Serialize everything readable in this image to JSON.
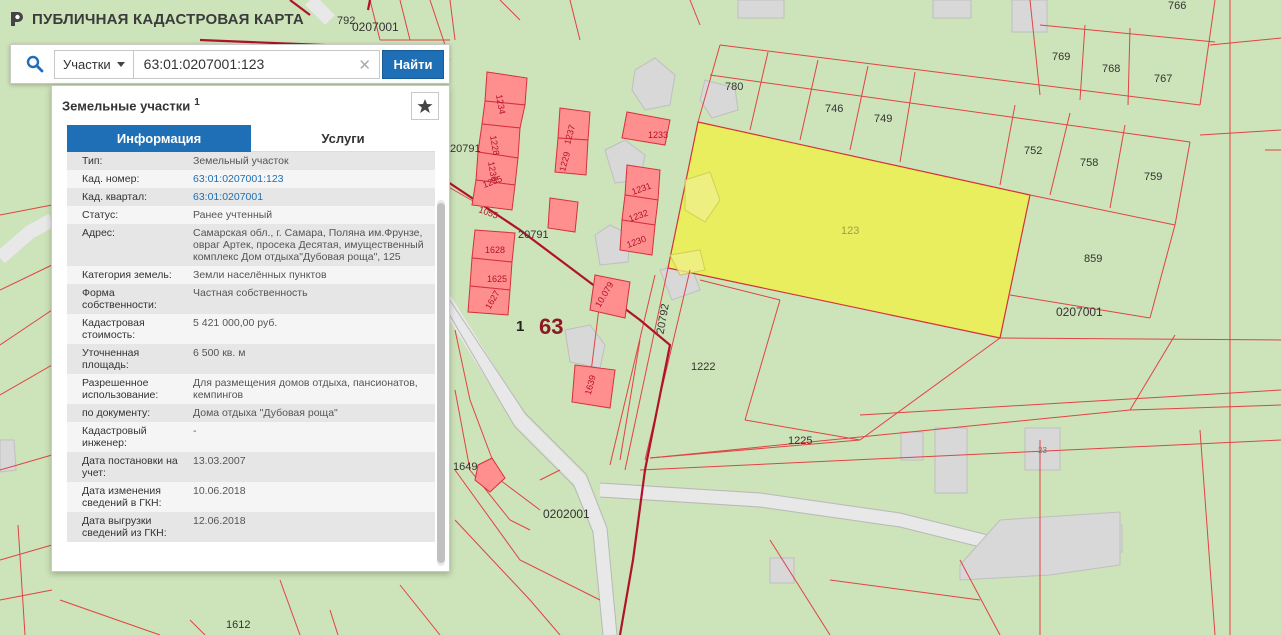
{
  "app": {
    "title": "ПУБЛИЧНАЯ КАДАСТРОВАЯ КАРТА"
  },
  "search": {
    "type_label": "Участки",
    "query": "63:01:0207001:123",
    "button_label": "Найти"
  },
  "panel": {
    "title": "Земельные участки",
    "count": "1",
    "tabs": [
      {
        "label": "Информация",
        "active": true
      },
      {
        "label": "Услуги",
        "active": false
      }
    ],
    "rows": [
      {
        "key": "Тип:",
        "value": "Земельный участок"
      },
      {
        "key": "Кад. номер:",
        "value": "63:01:0207001:123",
        "link": true
      },
      {
        "key": "Кад. квартал:",
        "value": "63:01:0207001",
        "link": true
      },
      {
        "key": "Статус:",
        "value": "Ранее учтенный"
      },
      {
        "key": "Адрес:",
        "value": "Самарская обл., г. Самара, Поляна им.Фрунзе, овраг Артек, просека Десятая, имущественный комплекс Дом отдыха\"Дубовая роща\", 125"
      },
      {
        "key": "Категория земель:",
        "value": "Земли населённых пунктов"
      },
      {
        "key": "Форма собственности:",
        "value": "Частная собственность"
      },
      {
        "key": "Кадастровая стоимость:",
        "value": "5 421 000,00 руб."
      },
      {
        "key": "Уточненная площадь:",
        "value": "6 500 кв. м"
      },
      {
        "key": "Разрешенное использование:",
        "value": "Для размещения домов отдыха, пансионатов, кемпингов"
      },
      {
        "key": "по документу:",
        "value": "Дома отдыха \"Дубовая роща\""
      },
      {
        "key": "Кадастровый инженер:",
        "value": "-"
      },
      {
        "key": "Дата постановки на учет:",
        "value": "13.03.2007"
      },
      {
        "key": "Дата изменения сведений в ГКН:",
        "value": "10.06.2018"
      },
      {
        "key": "Дата выгрузки сведений из ГКН:",
        "value": "12.06.2018"
      }
    ]
  },
  "map": {
    "colors": {
      "background": "#cde3b9",
      "boundary": "#d6303a",
      "selected": "#e8ee5e",
      "building": "#ff8f8f",
      "road": "#e6e6e6"
    },
    "labels": [
      "792",
      "0207001",
      "766",
      "780",
      "746",
      "749",
      "769",
      "768",
      "767",
      "752",
      "758",
      "759",
      "859",
      "123",
      "0207001",
      "1222",
      "1225",
      "0202001",
      "1649",
      "1612",
      "20791",
      "20791",
      "20792",
      "1",
      "63",
      "1233",
      "1231",
      "1232",
      "1230",
      "1229",
      "1237",
      "1628",
      "1625",
      "1627",
      "1228",
      "1236",
      "1235",
      "1234",
      "1639",
      "10.079",
      "1055",
      "23"
    ]
  }
}
